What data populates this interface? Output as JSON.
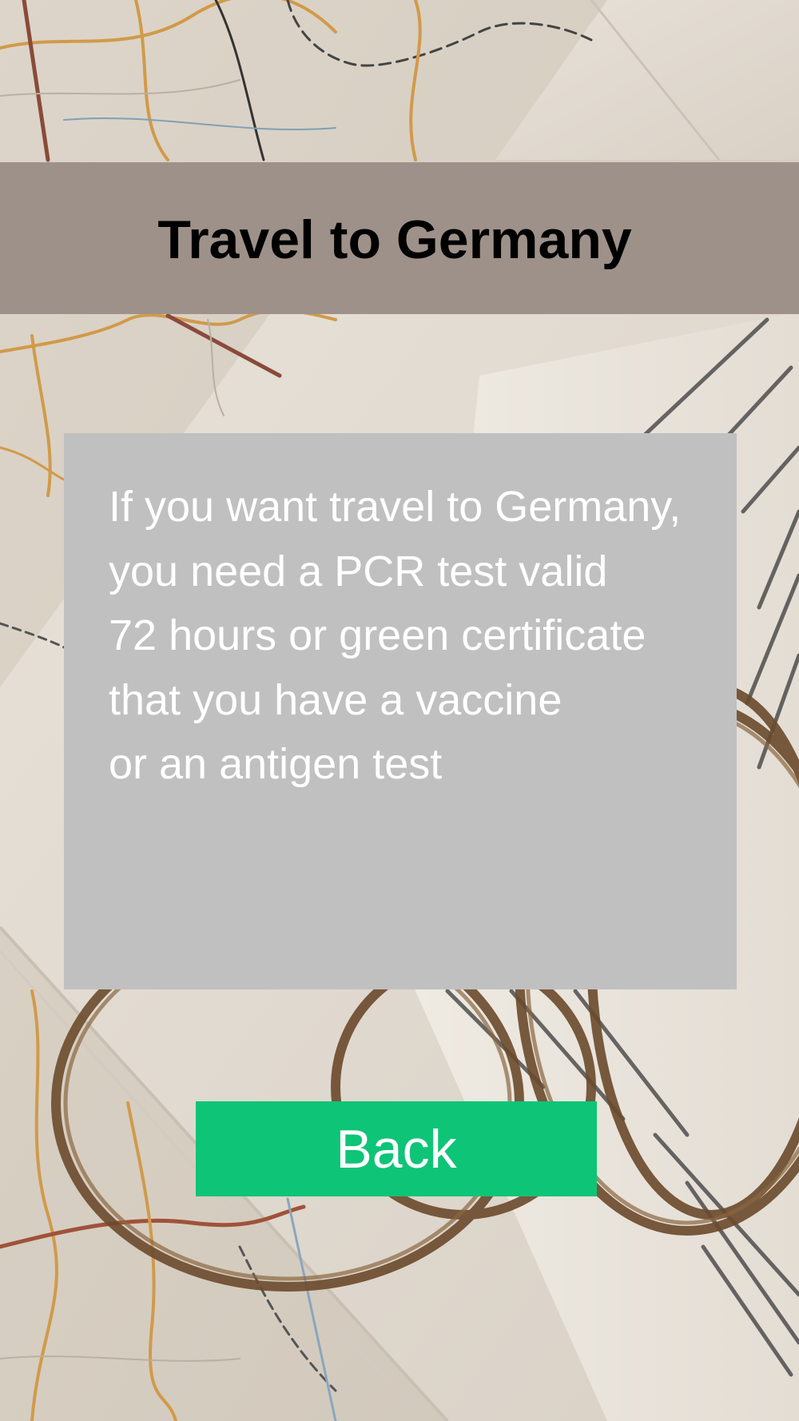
{
  "header": {
    "title": "Travel to Germany"
  },
  "info_card": {
    "lines": [
      "If you want travel to Germany,",
      "you need a PCR test valid",
      "72 hours or green certificate",
      "that you have a vaccine",
      "or an antigen test"
    ]
  },
  "back_button": {
    "label": "Back"
  },
  "background": {
    "description_icon": "map-book-bracelets-photo"
  },
  "colors": {
    "header_bg": "#9e918a",
    "card_bg": "#c0c0c0",
    "button_bg": "#0ec477",
    "title_text": "#000000",
    "card_text": "#ffffff",
    "button_text": "#ffffff"
  }
}
